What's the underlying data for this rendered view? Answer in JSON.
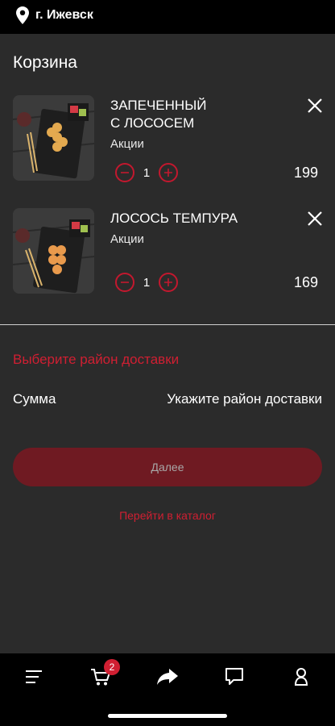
{
  "header": {
    "city": "г. Ижевск"
  },
  "cart": {
    "title": "Корзина",
    "items": [
      {
        "name": "ЗАПЕЧЕННЫЙ\nС ЛОСОСЕМ",
        "category": "Акции",
        "quantity": "1",
        "price": "199"
      },
      {
        "name": "ЛОСОСЬ ТЕМПУРА",
        "category": "Акции",
        "quantity": "1",
        "price": "169"
      }
    ]
  },
  "delivery": {
    "select_district": "Выберите район доставки",
    "sum_label": "Сумма",
    "sum_value": "Укажите район доставки"
  },
  "actions": {
    "next_label": "Далее",
    "catalog_link": "Перейти в каталог"
  },
  "tabbar": {
    "cart_badge": "2",
    "icons": [
      "menu-icon",
      "cart-icon",
      "share-icon",
      "chat-icon",
      "profile-icon"
    ]
  },
  "colors": {
    "accent": "#d01f32",
    "button_bg": "#6f1a22",
    "background": "#2b2b2b"
  }
}
